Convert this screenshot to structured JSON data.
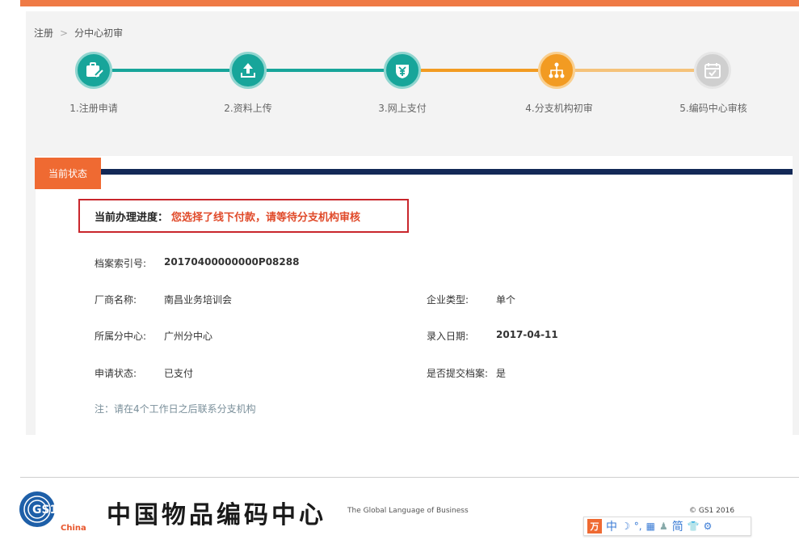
{
  "breadcrumb": {
    "items": [
      "注册",
      "分中心初审"
    ],
    "separator": ">"
  },
  "steps": [
    {
      "label": "1.注册申请",
      "icon": "form-icon",
      "state": "done"
    },
    {
      "label": "2.资料上传",
      "icon": "upload-icon",
      "state": "done"
    },
    {
      "label": "3.网上支付",
      "icon": "yen-icon",
      "state": "done"
    },
    {
      "label": "4.分支机构初审",
      "icon": "branch-network-icon",
      "state": "current"
    },
    {
      "label": "5.编码中心审核",
      "icon": "calendar-check-icon",
      "state": "pending"
    }
  ],
  "colors": {
    "done": "#17a59a",
    "current": "#f29b22",
    "pending": "#c8c8c8",
    "accent": "#ef6a32",
    "navy": "#132957",
    "alert": "#c9262c"
  },
  "status": {
    "tab_label": "当前状态",
    "progress_label": "当前办理进度：",
    "progress_value": "您选择了线下付款，请等待分支机构审核"
  },
  "details": {
    "file_no_label": "档案索引号:",
    "file_no": "20170400000000P08288",
    "company_label": "厂商名称:",
    "company": "南昌业务培训会",
    "type_label": "企业类型:",
    "type": "单个",
    "center_label": "所属分中心:",
    "center": "广州分中心",
    "date_label": "录入日期:",
    "date": "2017-04-11",
    "apply_label": "申请状态:",
    "apply": "已支付",
    "submitted_label": "是否提交档案:",
    "submitted": "是"
  },
  "note": "注：请在4个工作日之后联系分支机构",
  "footer": {
    "logo_text": "GS1",
    "logo_sub": "China",
    "cn_name": "中国物品编码中心",
    "tagline": "The Global Language of Business",
    "copyright": "© GS1 2016"
  },
  "toolbar": {
    "logo_char": "万",
    "items": [
      "中",
      "简"
    ]
  }
}
